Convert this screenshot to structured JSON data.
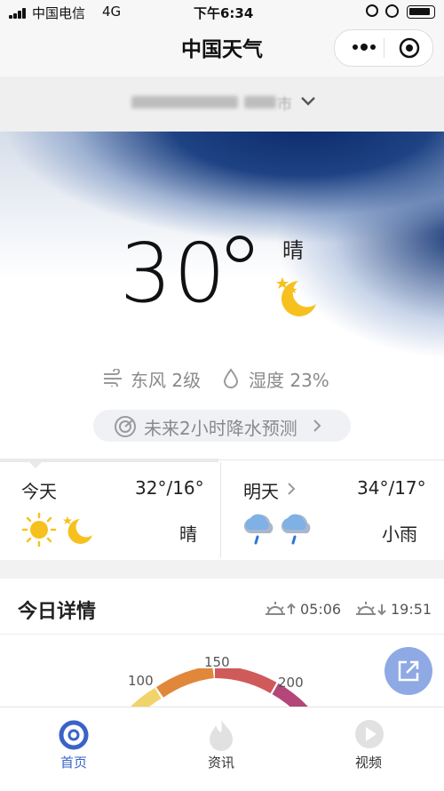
{
  "status_bar": {
    "carrier": "中国电信",
    "network": "4G",
    "time": "下午6:34",
    "battery_level": 0.9
  },
  "header": {
    "title": "中国天气"
  },
  "location": {
    "city": "市"
  },
  "current": {
    "temperature": "30",
    "condition": "晴",
    "wind": "东风 2级",
    "humidity": "湿度 23%",
    "rain_forecast": "未来2小时降水预测"
  },
  "forecast": {
    "today": {
      "label": "今天",
      "temp": "32°/16°",
      "condition": "晴"
    },
    "tomorrow": {
      "label": "明天",
      "temp": "34°/17°",
      "condition": "小雨"
    }
  },
  "detail": {
    "title": "今日详情",
    "sunrise": "05:06",
    "sunset": "19:51",
    "gauge_labels": [
      "100",
      "150",
      "200"
    ]
  },
  "tabbar": {
    "items": [
      {
        "label": "首页",
        "active": true
      },
      {
        "label": "资讯",
        "active": false
      },
      {
        "label": "视频",
        "active": false
      }
    ]
  },
  "colors": {
    "accent": "#3a63c8",
    "sun": "#f6c11f",
    "rain": "#2d74d6",
    "gauge_orange": "#e0873a",
    "gauge_red": "#cf5a5a"
  }
}
